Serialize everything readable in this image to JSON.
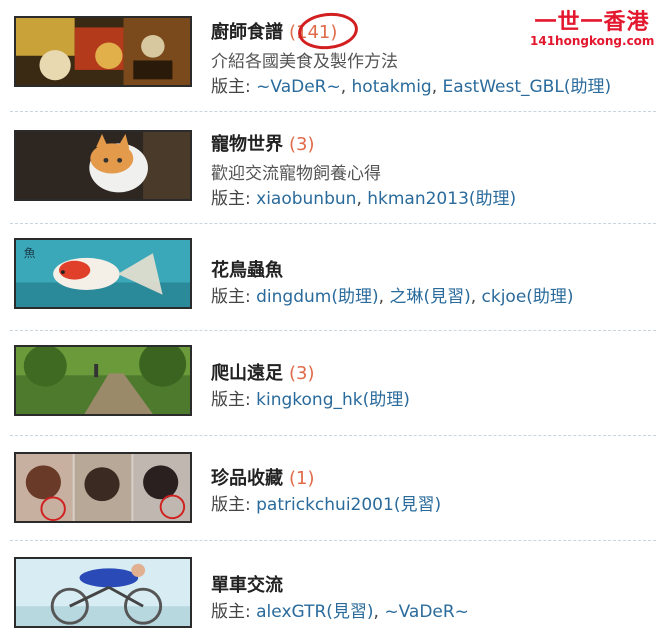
{
  "logo": {
    "main": "一世一香港",
    "sub": "141hongkong.com"
  },
  "forums": [
    {
      "title": "廚師食譜",
      "count": "(141)",
      "description": "介紹各國美食及製作方法",
      "moderator_label": "版主:",
      "moderators": [
        {
          "name": "~VaDeR~",
          "role": ""
        },
        {
          "name": "hotakmig",
          "role": ""
        },
        {
          "name": "EastWest_GBL",
          "role": "(助理)"
        }
      ]
    },
    {
      "title": "寵物世界",
      "count": "(3)",
      "description": "歡迎交流寵物飼養心得",
      "moderator_label": "版主:",
      "moderators": [
        {
          "name": "xiaobunbun",
          "role": ""
        },
        {
          "name": "hkman2013",
          "role": "(助理)"
        }
      ]
    },
    {
      "title": "花鳥蟲魚",
      "count": "",
      "description": "",
      "moderator_label": "版主:",
      "moderators": [
        {
          "name": "dingdum",
          "role": "(助理)"
        },
        {
          "name": "之琳",
          "role": "(見習)"
        },
        {
          "name": "ckjoe",
          "role": "(助理)"
        }
      ]
    },
    {
      "title": "爬山遠足",
      "count": "(3)",
      "description": "",
      "moderator_label": "版主:",
      "moderators": [
        {
          "name": "kingkong_hk",
          "role": "(助理)"
        }
      ]
    },
    {
      "title": "珍品收藏",
      "count": "(1)",
      "description": "",
      "moderator_label": "版主:",
      "moderators": [
        {
          "name": "patrickchui2001",
          "role": "(見習)"
        }
      ]
    },
    {
      "title": "單車交流",
      "count": "",
      "description": "",
      "moderator_label": "版主:",
      "moderators": [
        {
          "name": "alexGTR",
          "role": "(見習)"
        },
        {
          "name": "~VaDeR~",
          "role": ""
        }
      ]
    }
  ]
}
